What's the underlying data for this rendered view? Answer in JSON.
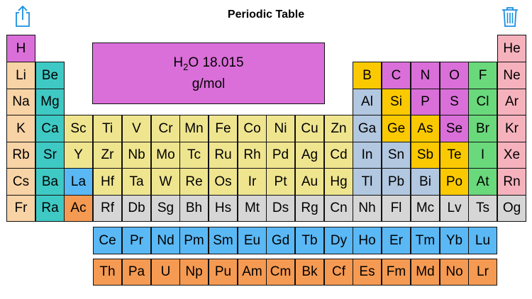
{
  "header": {
    "title": "Periodic Table"
  },
  "icons": {
    "share": "share-icon",
    "trash": "trash-icon"
  },
  "colors": {
    "accent": "#1a8fe0",
    "categories": {
      "nonmetal": "#da6fd9",
      "noble_gas": "#f5b2bd",
      "alkali_metal": "#f8d3a5",
      "alkaline_earth": "#3fc9c4",
      "transition_metal": "#efe58f",
      "post_transition": "#b2c7e0",
      "metalloid": "#fbc901",
      "halogen": "#69d97c",
      "lanthanide": "#5ab8f5",
      "actinide": "#f59a52",
      "unknown": "#d6d6d6"
    }
  },
  "display": {
    "formula_main": "H",
    "formula_subscript": "2",
    "formula_tail": "O 18.015",
    "unit": "g/mol"
  },
  "elements": [
    {
      "s": "H",
      "r": 1,
      "c": 1,
      "cat": "nonmetal"
    },
    {
      "s": "He",
      "r": 1,
      "c": 18,
      "cat": "noble_gas"
    },
    {
      "s": "Li",
      "r": 2,
      "c": 1,
      "cat": "alkali_metal"
    },
    {
      "s": "Be",
      "r": 2,
      "c": 2,
      "cat": "alkaline_earth"
    },
    {
      "s": "B",
      "r": 2,
      "c": 13,
      "cat": "metalloid"
    },
    {
      "s": "C",
      "r": 2,
      "c": 14,
      "cat": "nonmetal"
    },
    {
      "s": "N",
      "r": 2,
      "c": 15,
      "cat": "nonmetal"
    },
    {
      "s": "O",
      "r": 2,
      "c": 16,
      "cat": "nonmetal"
    },
    {
      "s": "F",
      "r": 2,
      "c": 17,
      "cat": "halogen"
    },
    {
      "s": "Ne",
      "r": 2,
      "c": 18,
      "cat": "noble_gas"
    },
    {
      "s": "Na",
      "r": 3,
      "c": 1,
      "cat": "alkali_metal"
    },
    {
      "s": "Mg",
      "r": 3,
      "c": 2,
      "cat": "alkaline_earth"
    },
    {
      "s": "Al",
      "r": 3,
      "c": 13,
      "cat": "post_transition"
    },
    {
      "s": "Si",
      "r": 3,
      "c": 14,
      "cat": "metalloid"
    },
    {
      "s": "P",
      "r": 3,
      "c": 15,
      "cat": "nonmetal"
    },
    {
      "s": "S",
      "r": 3,
      "c": 16,
      "cat": "nonmetal"
    },
    {
      "s": "Cl",
      "r": 3,
      "c": 17,
      "cat": "halogen"
    },
    {
      "s": "Ar",
      "r": 3,
      "c": 18,
      "cat": "noble_gas"
    },
    {
      "s": "K",
      "r": 4,
      "c": 1,
      "cat": "alkali_metal"
    },
    {
      "s": "Ca",
      "r": 4,
      "c": 2,
      "cat": "alkaline_earth"
    },
    {
      "s": "Sc",
      "r": 4,
      "c": 3,
      "cat": "transition_metal"
    },
    {
      "s": "Ti",
      "r": 4,
      "c": 4,
      "cat": "transition_metal"
    },
    {
      "s": "V",
      "r": 4,
      "c": 5,
      "cat": "transition_metal"
    },
    {
      "s": "Cr",
      "r": 4,
      "c": 6,
      "cat": "transition_metal"
    },
    {
      "s": "Mn",
      "r": 4,
      "c": 7,
      "cat": "transition_metal"
    },
    {
      "s": "Fe",
      "r": 4,
      "c": 8,
      "cat": "transition_metal"
    },
    {
      "s": "Co",
      "r": 4,
      "c": 9,
      "cat": "transition_metal"
    },
    {
      "s": "Ni",
      "r": 4,
      "c": 10,
      "cat": "transition_metal"
    },
    {
      "s": "Cu",
      "r": 4,
      "c": 11,
      "cat": "transition_metal"
    },
    {
      "s": "Zn",
      "r": 4,
      "c": 12,
      "cat": "transition_metal"
    },
    {
      "s": "Ga",
      "r": 4,
      "c": 13,
      "cat": "post_transition"
    },
    {
      "s": "Ge",
      "r": 4,
      "c": 14,
      "cat": "metalloid"
    },
    {
      "s": "As",
      "r": 4,
      "c": 15,
      "cat": "metalloid"
    },
    {
      "s": "Se",
      "r": 4,
      "c": 16,
      "cat": "nonmetal"
    },
    {
      "s": "Br",
      "r": 4,
      "c": 17,
      "cat": "halogen"
    },
    {
      "s": "Kr",
      "r": 4,
      "c": 18,
      "cat": "noble_gas"
    },
    {
      "s": "Rb",
      "r": 5,
      "c": 1,
      "cat": "alkali_metal"
    },
    {
      "s": "Sr",
      "r": 5,
      "c": 2,
      "cat": "alkaline_earth"
    },
    {
      "s": "Y",
      "r": 5,
      "c": 3,
      "cat": "transition_metal"
    },
    {
      "s": "Zr",
      "r": 5,
      "c": 4,
      "cat": "transition_metal"
    },
    {
      "s": "Nb",
      "r": 5,
      "c": 5,
      "cat": "transition_metal"
    },
    {
      "s": "Mo",
      "r": 5,
      "c": 6,
      "cat": "transition_metal"
    },
    {
      "s": "Tc",
      "r": 5,
      "c": 7,
      "cat": "transition_metal"
    },
    {
      "s": "Ru",
      "r": 5,
      "c": 8,
      "cat": "transition_metal"
    },
    {
      "s": "Rh",
      "r": 5,
      "c": 9,
      "cat": "transition_metal"
    },
    {
      "s": "Pd",
      "r": 5,
      "c": 10,
      "cat": "transition_metal"
    },
    {
      "s": "Ag",
      "r": 5,
      "c": 11,
      "cat": "transition_metal"
    },
    {
      "s": "Cd",
      "r": 5,
      "c": 12,
      "cat": "transition_metal"
    },
    {
      "s": "In",
      "r": 5,
      "c": 13,
      "cat": "post_transition"
    },
    {
      "s": "Sn",
      "r": 5,
      "c": 14,
      "cat": "post_transition"
    },
    {
      "s": "Sb",
      "r": 5,
      "c": 15,
      "cat": "metalloid"
    },
    {
      "s": "Te",
      "r": 5,
      "c": 16,
      "cat": "metalloid"
    },
    {
      "s": "I",
      "r": 5,
      "c": 17,
      "cat": "halogen"
    },
    {
      "s": "Xe",
      "r": 5,
      "c": 18,
      "cat": "noble_gas"
    },
    {
      "s": "Cs",
      "r": 6,
      "c": 1,
      "cat": "alkali_metal"
    },
    {
      "s": "Ba",
      "r": 6,
      "c": 2,
      "cat": "alkaline_earth"
    },
    {
      "s": "La",
      "r": 6,
      "c": 3,
      "cat": "lanthanide"
    },
    {
      "s": "Hf",
      "r": 6,
      "c": 4,
      "cat": "transition_metal"
    },
    {
      "s": "Ta",
      "r": 6,
      "c": 5,
      "cat": "transition_metal"
    },
    {
      "s": "W",
      "r": 6,
      "c": 6,
      "cat": "transition_metal"
    },
    {
      "s": "Re",
      "r": 6,
      "c": 7,
      "cat": "transition_metal"
    },
    {
      "s": "Os",
      "r": 6,
      "c": 8,
      "cat": "transition_metal"
    },
    {
      "s": "Ir",
      "r": 6,
      "c": 9,
      "cat": "transition_metal"
    },
    {
      "s": "Pt",
      "r": 6,
      "c": 10,
      "cat": "transition_metal"
    },
    {
      "s": "Au",
      "r": 6,
      "c": 11,
      "cat": "transition_metal"
    },
    {
      "s": "Hg",
      "r": 6,
      "c": 12,
      "cat": "transition_metal"
    },
    {
      "s": "Tl",
      "r": 6,
      "c": 13,
      "cat": "post_transition"
    },
    {
      "s": "Pb",
      "r": 6,
      "c": 14,
      "cat": "post_transition"
    },
    {
      "s": "Bi",
      "r": 6,
      "c": 15,
      "cat": "post_transition"
    },
    {
      "s": "Po",
      "r": 6,
      "c": 16,
      "cat": "metalloid"
    },
    {
      "s": "At",
      "r": 6,
      "c": 17,
      "cat": "halogen"
    },
    {
      "s": "Rn",
      "r": 6,
      "c": 18,
      "cat": "noble_gas"
    },
    {
      "s": "Fr",
      "r": 7,
      "c": 1,
      "cat": "alkali_metal"
    },
    {
      "s": "Ra",
      "r": 7,
      "c": 2,
      "cat": "alkaline_earth"
    },
    {
      "s": "Ac",
      "r": 7,
      "c": 3,
      "cat": "actinide"
    },
    {
      "s": "Rf",
      "r": 7,
      "c": 4,
      "cat": "unknown"
    },
    {
      "s": "Db",
      "r": 7,
      "c": 5,
      "cat": "unknown"
    },
    {
      "s": "Sg",
      "r": 7,
      "c": 6,
      "cat": "unknown"
    },
    {
      "s": "Bh",
      "r": 7,
      "c": 7,
      "cat": "unknown"
    },
    {
      "s": "Hs",
      "r": 7,
      "c": 8,
      "cat": "unknown"
    },
    {
      "s": "Mt",
      "r": 7,
      "c": 9,
      "cat": "unknown"
    },
    {
      "s": "Ds",
      "r": 7,
      "c": 10,
      "cat": "unknown"
    },
    {
      "s": "Rg",
      "r": 7,
      "c": 11,
      "cat": "unknown"
    },
    {
      "s": "Cn",
      "r": 7,
      "c": 12,
      "cat": "unknown"
    },
    {
      "s": "Nh",
      "r": 7,
      "c": 13,
      "cat": "unknown"
    },
    {
      "s": "Fl",
      "r": 7,
      "c": 14,
      "cat": "unknown"
    },
    {
      "s": "Mc",
      "r": 7,
      "c": 15,
      "cat": "unknown"
    },
    {
      "s": "Lv",
      "r": 7,
      "c": 16,
      "cat": "unknown"
    },
    {
      "s": "Ts",
      "r": 7,
      "c": 17,
      "cat": "unknown"
    },
    {
      "s": "Og",
      "r": 7,
      "c": 18,
      "cat": "unknown"
    },
    {
      "s": "Ce",
      "r": 8,
      "c": 4,
      "cat": "lanthanide"
    },
    {
      "s": "Pr",
      "r": 8,
      "c": 5,
      "cat": "lanthanide"
    },
    {
      "s": "Nd",
      "r": 8,
      "c": 6,
      "cat": "lanthanide"
    },
    {
      "s": "Pm",
      "r": 8,
      "c": 7,
      "cat": "lanthanide"
    },
    {
      "s": "Sm",
      "r": 8,
      "c": 8,
      "cat": "lanthanide"
    },
    {
      "s": "Eu",
      "r": 8,
      "c": 9,
      "cat": "lanthanide"
    },
    {
      "s": "Gd",
      "r": 8,
      "c": 10,
      "cat": "lanthanide"
    },
    {
      "s": "Tb",
      "r": 8,
      "c": 11,
      "cat": "lanthanide"
    },
    {
      "s": "Dy",
      "r": 8,
      "c": 12,
      "cat": "lanthanide"
    },
    {
      "s": "Ho",
      "r": 8,
      "c": 13,
      "cat": "lanthanide"
    },
    {
      "s": "Er",
      "r": 8,
      "c": 14,
      "cat": "lanthanide"
    },
    {
      "s": "Tm",
      "r": 8,
      "c": 15,
      "cat": "lanthanide"
    },
    {
      "s": "Yb",
      "r": 8,
      "c": 16,
      "cat": "lanthanide"
    },
    {
      "s": "Lu",
      "r": 8,
      "c": 17,
      "cat": "lanthanide"
    },
    {
      "s": "Th",
      "r": 9,
      "c": 4,
      "cat": "actinide"
    },
    {
      "s": "Pa",
      "r": 9,
      "c": 5,
      "cat": "actinide"
    },
    {
      "s": "U",
      "r": 9,
      "c": 6,
      "cat": "actinide"
    },
    {
      "s": "Np",
      "r": 9,
      "c": 7,
      "cat": "actinide"
    },
    {
      "s": "Pu",
      "r": 9,
      "c": 8,
      "cat": "actinide"
    },
    {
      "s": "Am",
      "r": 9,
      "c": 9,
      "cat": "actinide"
    },
    {
      "s": "Cm",
      "r": 9,
      "c": 10,
      "cat": "actinide"
    },
    {
      "s": "Bk",
      "r": 9,
      "c": 11,
      "cat": "actinide"
    },
    {
      "s": "Cf",
      "r": 9,
      "c": 12,
      "cat": "actinide"
    },
    {
      "s": "Es",
      "r": 9,
      "c": 13,
      "cat": "actinide"
    },
    {
      "s": "Fm",
      "r": 9,
      "c": 14,
      "cat": "actinide"
    },
    {
      "s": "Md",
      "r": 9,
      "c": 15,
      "cat": "actinide"
    },
    {
      "s": "No",
      "r": 9,
      "c": 16,
      "cat": "actinide"
    },
    {
      "s": "Lr",
      "r": 9,
      "c": 17,
      "cat": "actinide"
    }
  ]
}
